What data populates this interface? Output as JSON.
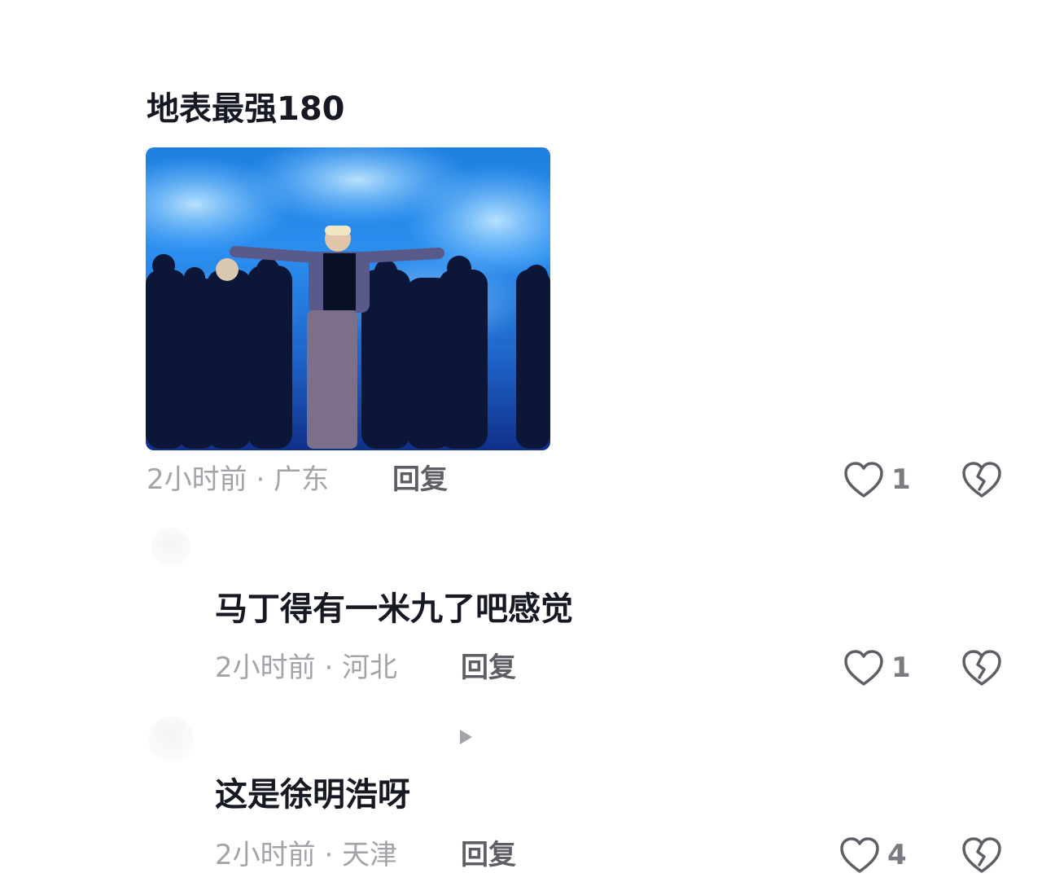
{
  "comments": [
    {
      "text": "地表最强180",
      "meta": "2小时前 · 广东",
      "reply_label": "回复",
      "likes": "1"
    },
    {
      "text": "马丁得有一米九了吧感觉",
      "meta": "2小时前 · 河北",
      "reply_label": "回复",
      "likes": "1"
    },
    {
      "text": "这是徐明浩呀",
      "meta": "2小时前 · 天津",
      "reply_label": "回复",
      "likes": "4"
    }
  ],
  "icons": {
    "like": "heart-outline-icon",
    "dislike": "broken-heart-icon",
    "expand": "play-triangle-icon"
  },
  "colors": {
    "text_primary": "#161823",
    "text_meta": "#a3a4aa",
    "reply_label": "#5e5f66",
    "icon": "#5e5f66"
  }
}
